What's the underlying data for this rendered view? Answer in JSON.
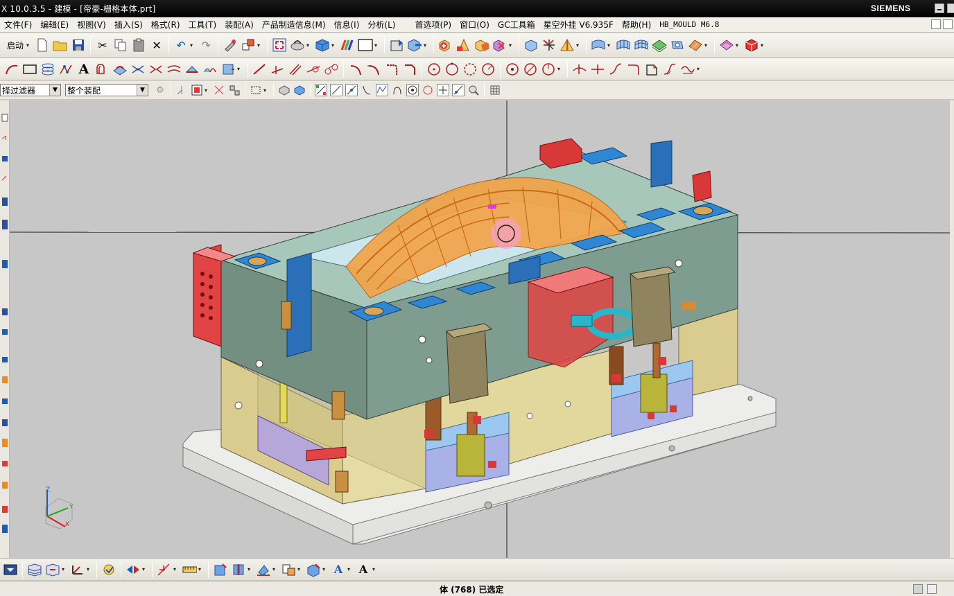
{
  "window": {
    "title": "X 10.0.3.5 - 建模 - [帝豪-栅格本体.prt]",
    "brand": "SIEMENS"
  },
  "menu": [
    "文件(F)",
    "编辑(E)",
    "视图(V)",
    "插入(S)",
    "格式(R)",
    "工具(T)",
    "装配(A)",
    "产品制造信息(M)",
    "信息(I)",
    "分析(L)",
    "首选项(P)",
    "窗口(O)",
    "GC工具箱",
    "星空外挂 V6.935F",
    "帮助(H)",
    "HB_MOULD M6.8"
  ],
  "toolbar": {
    "start_label": "启动"
  },
  "selection_bar": {
    "filter_value": "择过滤器",
    "scope_value": "整个装配"
  },
  "triad": {
    "z_label": "Z",
    "y_label": "Y",
    "x_label": "X"
  },
  "status": {
    "message": "体 (768) 已选定"
  },
  "icons": {
    "new": "new-file-icon",
    "open": "open-folder-icon",
    "save": "save-icon",
    "cut": "cut-icon",
    "copy": "copy-icon",
    "paste": "paste-icon",
    "delete": "delete-icon",
    "undo": "undo-icon",
    "redo": "redo-icon"
  },
  "colors": {
    "titlebar": "#000000",
    "viewport": "#c7c7c7",
    "mold_plate": "#6f8f80",
    "clamp_block": "#d9cc8e",
    "part": "#f2a44a",
    "pad": "#2f86d3",
    "red_block": "#e04444"
  }
}
